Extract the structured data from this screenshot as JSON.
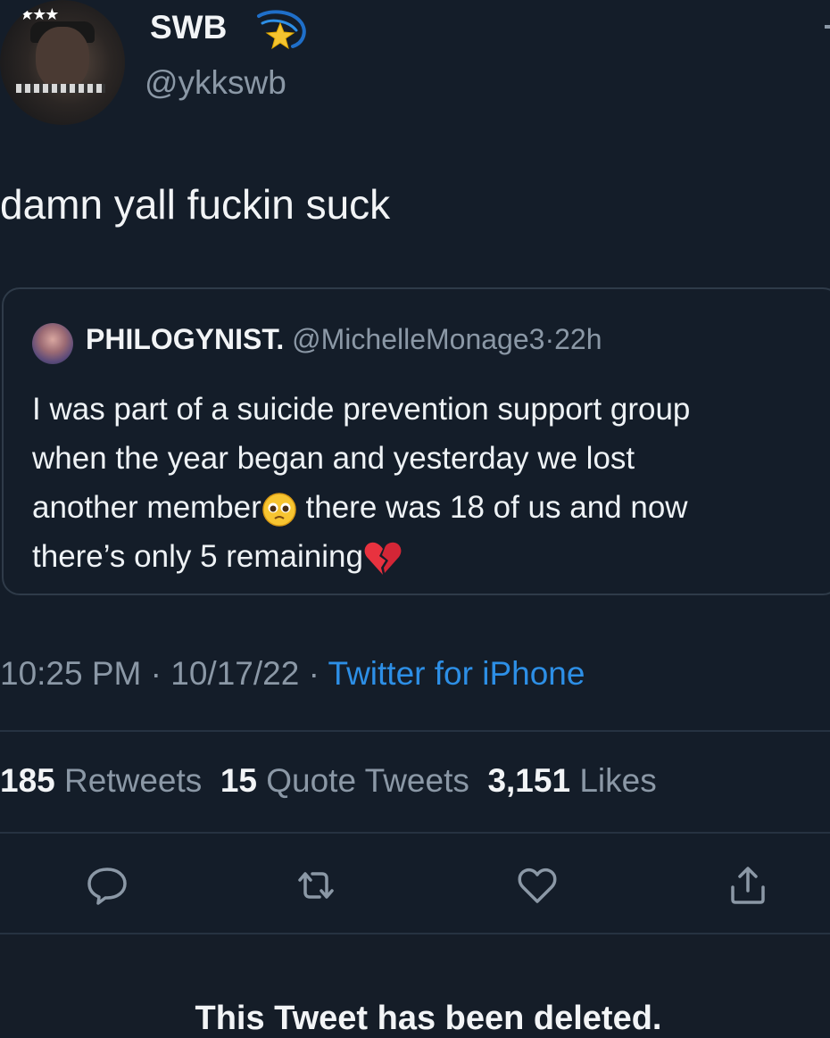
{
  "author": {
    "display_name": "SWB",
    "handle": "@ykkswb",
    "avatar_icon": "avatar-photo",
    "badge_icon": "shooting-star-icon"
  },
  "tweet": {
    "text": "damn yall fuckin suck"
  },
  "quoted_tweet": {
    "display_name": "PHILOGYNIST.",
    "handle": "@MichelleMonage3",
    "separator": "·",
    "time": "22h",
    "lines": [
      "I was part of a suicide prevention support group",
      "when the year began and yesterday we lost",
      "another member",
      " there was 18 of us and now",
      "there’s only 5 remaining"
    ],
    "emoji_1": "pleading-face-icon",
    "emoji_2": "broken-heart-icon"
  },
  "meta": {
    "time": "10:25 PM",
    "separator": "·",
    "date": "10/17/22",
    "source": "Twitter for iPhone"
  },
  "stats": {
    "retweets_count": "185",
    "retweets_label": "Retweets",
    "quotes_count": "15",
    "quotes_label": "Quote Tweets",
    "likes_count": "3,151",
    "likes_label": "Likes"
  },
  "actions": [
    "reply-icon",
    "retweet-icon",
    "like-icon",
    "share-icon"
  ],
  "deleted_notice": "This Tweet has been deleted.",
  "colors": {
    "background": "#141d29",
    "secondary_text": "#8b98a6",
    "link": "#2d8fe6",
    "divider": "#263241"
  }
}
